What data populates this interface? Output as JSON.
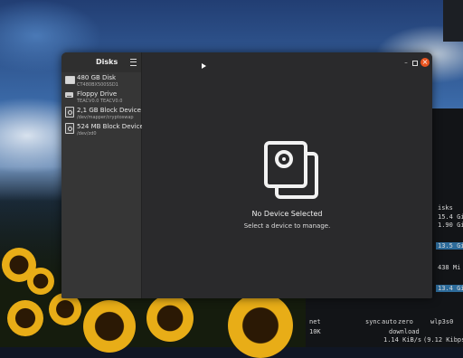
{
  "sidebar": {
    "title": "Disks",
    "devices": [
      {
        "name": "480 GB Disk",
        "subtitle": "CT480BX500SSD1",
        "icon": "hdd-icon"
      },
      {
        "name": "Floppy Drive",
        "subtitle": "TEACV0.0 TEACV0.0",
        "icon": "floppy-icon"
      },
      {
        "name": "2,1 GB Block Device",
        "subtitle": "/dev/mapper/cryptoswap",
        "icon": "block-device-icon"
      },
      {
        "name": "524 MB Block Device",
        "subtitle": "/dev/zd0",
        "icon": "block-device-icon"
      }
    ]
  },
  "main": {
    "empty_title": "No Device Selected",
    "empty_subtitle": "Select a device to manage."
  },
  "window_controls": {
    "minimize": "–",
    "close": "×"
  },
  "terminal": {
    "lines": [
      "isks",
      "15.4 Gi",
      "1.90 Gi",
      "13.5 Gi",
      "438 Mi",
      "13.4 Gi"
    ],
    "net_header": "net",
    "sync": "sync",
    "auto": "auto",
    "zero": "zero",
    "iface": "wlp3s0",
    "rate_label": "10K",
    "download": "download",
    "down_rate": "1.14 KiB/s",
    "down_bits": "(9.12 Kibps"
  },
  "colors": {
    "accent": "#e95420",
    "window_bg": "#2a2a2c",
    "sidebar_bg": "#363636"
  }
}
